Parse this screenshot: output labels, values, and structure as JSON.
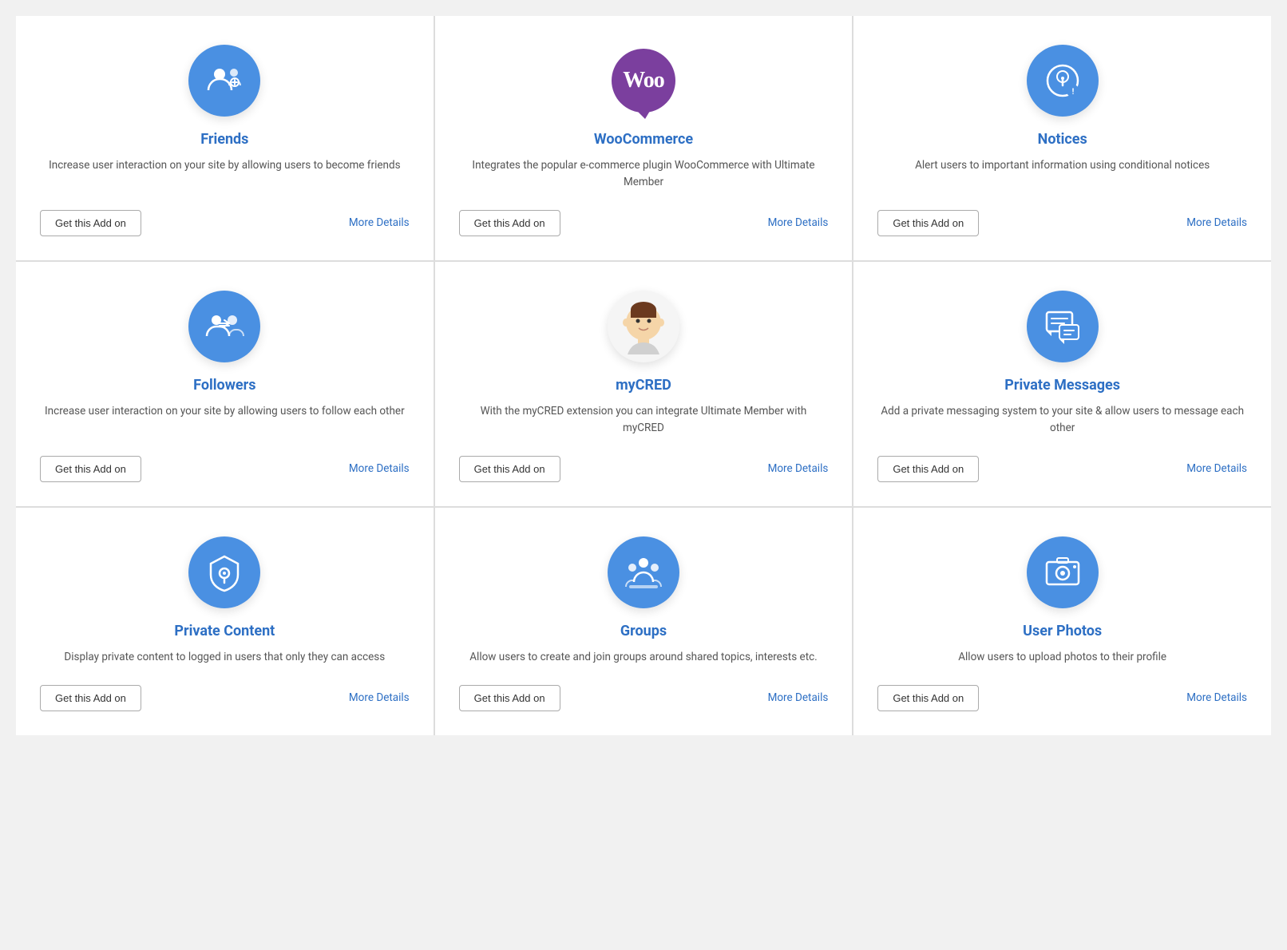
{
  "cards": [
    {
      "id": "friends",
      "title": "Friends",
      "description": "Increase user interaction on your site by allowing users to become friends",
      "icon_type": "blue_svg",
      "icon_name": "friends-icon",
      "btn_label": "Get this Add on",
      "link_label": "More Details"
    },
    {
      "id": "woocommerce",
      "title": "WooCommerce",
      "description": "Integrates the popular e-commerce plugin WooCommerce with Ultimate Member",
      "icon_type": "woo",
      "icon_name": "woocommerce-icon",
      "btn_label": "Get this Add on",
      "link_label": "More Details"
    },
    {
      "id": "notices",
      "title": "Notices",
      "description": "Alert users to important information using conditional notices",
      "icon_type": "blue_svg",
      "icon_name": "notices-icon",
      "btn_label": "Get this Add on",
      "link_label": "More Details"
    },
    {
      "id": "followers",
      "title": "Followers",
      "description": "Increase user interaction on your site by allowing users to follow each other",
      "icon_type": "blue_svg",
      "icon_name": "followers-icon",
      "btn_label": "Get this Add on",
      "link_label": "More Details"
    },
    {
      "id": "mycred",
      "title": "myCRED",
      "description": "With the myCRED extension you can integrate Ultimate Member with myCRED",
      "icon_type": "avatar",
      "icon_name": "mycred-icon",
      "btn_label": "Get this Add on",
      "link_label": "More Details"
    },
    {
      "id": "private-messages",
      "title": "Private Messages",
      "description": "Add a private messaging system to your site & allow users to message each other",
      "icon_type": "blue_svg",
      "icon_name": "private-messages-icon",
      "btn_label": "Get this Add on",
      "link_label": "More Details"
    },
    {
      "id": "private-content",
      "title": "Private Content",
      "description": "Display private content to logged in users that only they can access",
      "icon_type": "blue_svg",
      "icon_name": "private-content-icon",
      "btn_label": "Get this Add on",
      "link_label": "More Details"
    },
    {
      "id": "groups",
      "title": "Groups",
      "description": "Allow users to create and join groups around shared topics, interests etc.",
      "icon_type": "blue_svg",
      "icon_name": "groups-icon",
      "btn_label": "Get this Add on",
      "link_label": "More Details"
    },
    {
      "id": "user-photos",
      "title": "User Photos",
      "description": "Allow users to upload photos to their profile",
      "icon_type": "blue_svg",
      "icon_name": "user-photos-icon",
      "btn_label": "Get this Add on",
      "link_label": "More Details"
    }
  ]
}
